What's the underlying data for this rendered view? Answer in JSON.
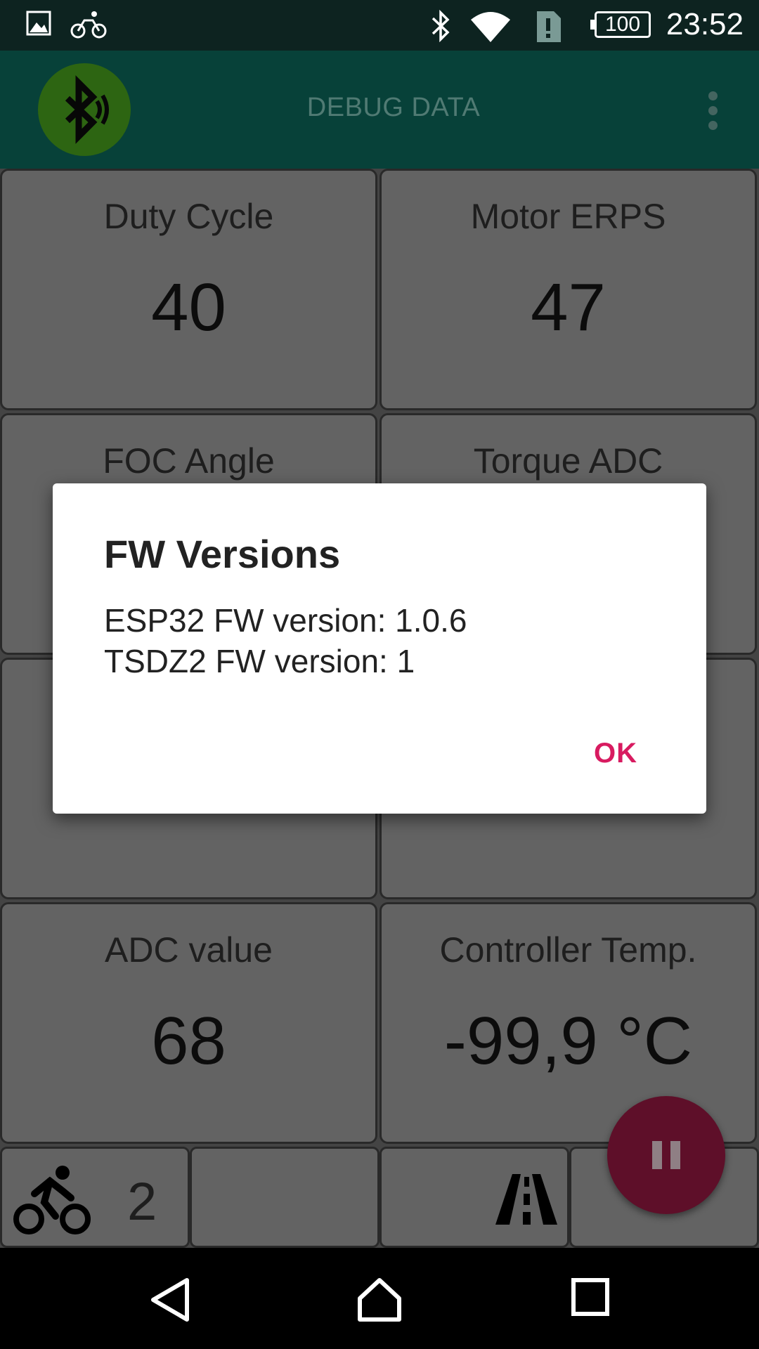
{
  "status_bar": {
    "time": "23:52",
    "battery": "100",
    "icons": [
      "image-icon",
      "bike-icon",
      "bluetooth-icon",
      "wifi-icon",
      "alert-icon",
      "battery-icon"
    ]
  },
  "toolbar": {
    "title": "DEBUG DATA",
    "bluetooth_button_icon": "bluetooth-connected-icon",
    "menu_icon": "overflow-menu-icon",
    "colors": {
      "toolbar": "#0a5a4f",
      "bt_button": "#3f8c1a"
    }
  },
  "cells": [
    {
      "label": "Duty Cycle",
      "value": "40"
    },
    {
      "label": "Motor ERPS",
      "value": "47"
    },
    {
      "label": "FOC Angle",
      "value": ""
    },
    {
      "label": "Torque ADC",
      "value": ""
    },
    {
      "label": "",
      "value": ""
    },
    {
      "label": "",
      "value": ""
    },
    {
      "label": "ADC value",
      "value": "68"
    },
    {
      "label": "Controller Temp.",
      "value": "-99,9 °C"
    }
  ],
  "bottom_bar": {
    "assist_level": "2",
    "assist_icon": "cyclist-icon",
    "road_icon": "road-icon"
  },
  "dialog": {
    "title": "FW Versions",
    "line1": "ESP32 FW version: 1.0.6",
    "line2": "TSDZ2 FW version: 1",
    "ok_label": "OK",
    "ok_color": "#d81b60"
  },
  "fab": {
    "icon": "pause-icon",
    "color": "#5e0f29"
  },
  "nav_bar": {
    "icons": [
      "back-icon",
      "home-icon",
      "recents-icon"
    ]
  }
}
